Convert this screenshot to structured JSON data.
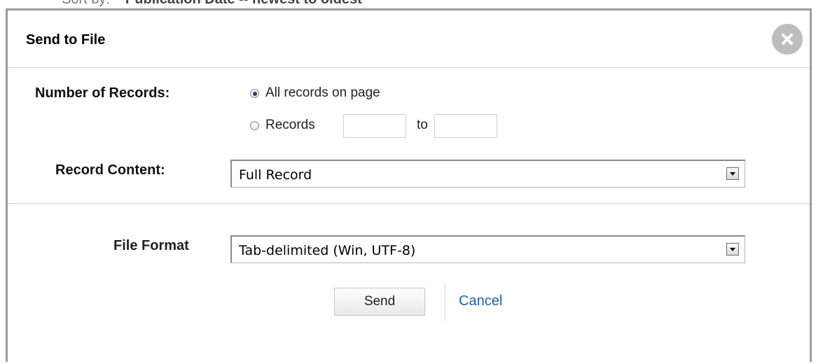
{
  "backdrop": {
    "sort_label": "Sort by:",
    "sort_value": "Publication Date -- newest to oldest"
  },
  "dialog": {
    "title": "Send to File",
    "close_icon": "close-x-icon"
  },
  "records": {
    "label": "Number of Records:",
    "option_all": "All records on page",
    "option_range": "Records",
    "range_to": "to",
    "range_from_value": "",
    "range_to_value": "",
    "selected": "all"
  },
  "content": {
    "label": "Record Content:",
    "selected": "Full Record"
  },
  "format": {
    "label": "File Format",
    "selected": "Tab-delimited (Win, UTF-8)"
  },
  "actions": {
    "send_label": "Send",
    "cancel_label": "Cancel"
  },
  "colors": {
    "link": "#1f5fa6",
    "border": "#9d9d9d",
    "close_bg": "#bdbdbd"
  }
}
